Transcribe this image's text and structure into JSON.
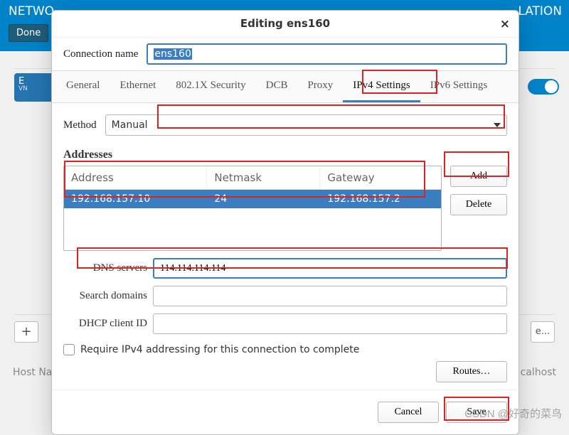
{
  "background": {
    "title_fragment_left": "NETWO",
    "title_fragment_right": "LATION",
    "done_button": "Done",
    "card_label": "E",
    "card_sub": "VN",
    "add_btn": "+",
    "e_btn": "e...",
    "host_left": "Host Na",
    "host_right": "calhost"
  },
  "dialog": {
    "title": "Editing ens160",
    "connection_name_label": "Connection name",
    "connection_name_value": "ens160",
    "tabs": [
      "General",
      "Ethernet",
      "802.1X Security",
      "DCB",
      "Proxy",
      "IPv4 Settings",
      "IPv6 Settings"
    ],
    "active_tab": "IPv4 Settings",
    "method_label": "Method",
    "method_value": "Manual",
    "addresses_title": "Addresses",
    "table": {
      "headers": [
        "Address",
        "Netmask",
        "Gateway"
      ],
      "rows": [
        {
          "address": "192.168.157.10",
          "netmask": "24",
          "gateway": "192.168.157.2"
        }
      ]
    },
    "add_label": "Add",
    "delete_label": "Delete",
    "dns_label": "DNS servers",
    "dns_value": "114.114.114.114",
    "search_domains_label": "Search domains",
    "search_domains_value": "",
    "dhcp_client_id_label": "DHCP client ID",
    "dhcp_client_id_value": "",
    "require_checkbox_label": "Require IPv4 addressing for this connection to complete",
    "require_checked": false,
    "routes_label": "Routes…",
    "cancel_label": "Cancel",
    "save_label": "Save"
  },
  "watermark": "CSDN @好奇的菜鸟"
}
